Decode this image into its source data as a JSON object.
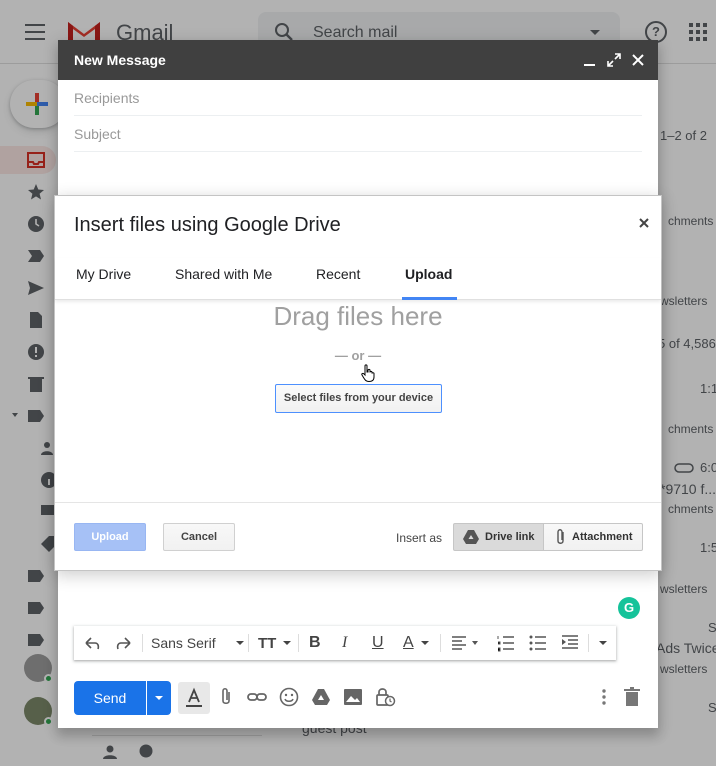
{
  "gmail": {
    "wordmark": "Gmail",
    "search_placeholder": "Search mail",
    "right_fragments": [
      "1–2 of 2",
      "chments",
      "wsletters",
      "5 of 4,586",
      "1:1",
      "chments",
      "6:0",
      "*9710 f...",
      "chments",
      "1:5",
      "wsletters",
      "S",
      "Ads Twice",
      "wsletters",
      "S"
    ],
    "footer_text": "guest post"
  },
  "compose": {
    "title": "New Message",
    "recipients_placeholder": "Recipients",
    "subject_placeholder": "Subject",
    "font_name": "Sans Serif",
    "send_label": "Send",
    "grammarly_letter": "G"
  },
  "dialog": {
    "title": "Insert files using Google Drive",
    "tabs": [
      "My Drive",
      "Shared with Me",
      "Recent",
      "Upload"
    ],
    "active_tab": "Upload",
    "drag_text": "Drag files here",
    "or_text": "— or —",
    "select_button": "Select files from your device",
    "upload_button": "Upload",
    "cancel_button": "Cancel",
    "insert_as_label": "Insert as",
    "drive_link_label": "Drive link",
    "attachment_label": "Attachment"
  },
  "colors": {
    "accent_blue": "#4285f4",
    "send_blue": "#1a73e8",
    "gmail_red": "#ea4335",
    "grammarly_green": "#15c39a"
  }
}
